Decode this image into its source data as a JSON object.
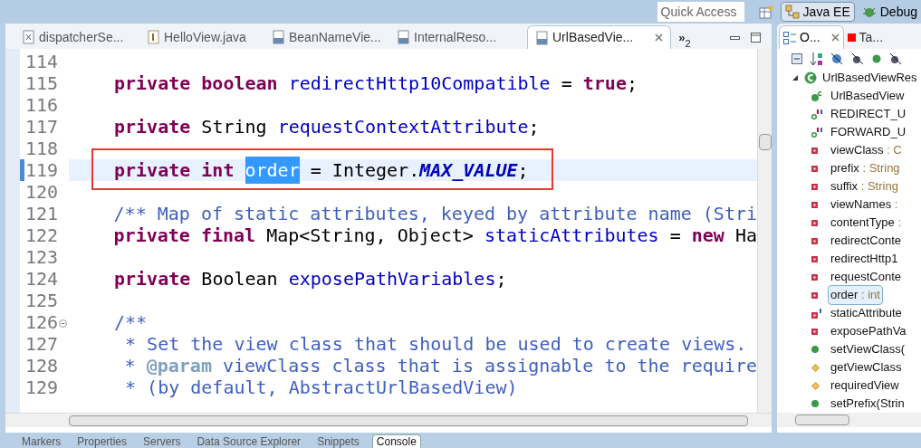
{
  "toolbar": {
    "quick_access": "Quick Access",
    "perspectives": [
      {
        "label": "Java EE",
        "selected": true,
        "kind": "javaee"
      },
      {
        "label": "Debug",
        "selected": false,
        "kind": "debug"
      }
    ]
  },
  "editor_tabs": [
    {
      "label": "dispatcherSe...",
      "kind": "xml",
      "selected": false
    },
    {
      "label": "HelloView.java",
      "kind": "java",
      "selected": false
    },
    {
      "label": "BeanNameVie...",
      "kind": "class",
      "selected": false
    },
    {
      "label": "InternalReso...",
      "kind": "class",
      "selected": false
    },
    {
      "label": "UrlBasedVie...",
      "kind": "class",
      "selected": true
    }
  ],
  "overflow": {
    "glyph": "»",
    "count": "2"
  },
  "code_lines": [
    {
      "number": "114"
    },
    {
      "number": "115",
      "tokens": [
        {
          "t": "private boolean",
          "kind": "keyword"
        },
        {
          "t": " redirectHttp10Compatible",
          "kind": "field"
        },
        {
          "t": " = ",
          "kind": "plain"
        },
        {
          "t": "true",
          "kind": "keyword"
        },
        {
          "t": ";",
          "kind": "plain"
        }
      ]
    },
    {
      "number": "116"
    },
    {
      "number": "117",
      "tokens": [
        {
          "t": "private",
          "kind": "keyword"
        },
        {
          "t": " String ",
          "kind": "plain"
        },
        {
          "t": "requestContextAttribute",
          "kind": "field"
        },
        {
          "t": ";",
          "kind": "plain"
        }
      ]
    },
    {
      "number": "118"
    },
    {
      "number": "119",
      "current": true,
      "boxed": true,
      "tokens": [
        {
          "t": "private int ",
          "kind": "keyword"
        },
        {
          "t": "order",
          "kind": "field",
          "selected": true
        },
        {
          "t": " = Integer.",
          "kind": "plain"
        },
        {
          "t": "MAX_VALUE",
          "kind": "constant"
        },
        {
          "t": ";",
          "kind": "plain"
        }
      ]
    },
    {
      "number": "120"
    },
    {
      "number": "121",
      "tokens": [
        {
          "t": "/** Map of static attributes, keyed by attribute name (Stri",
          "kind": "comment"
        }
      ]
    },
    {
      "number": "122",
      "tokens": [
        {
          "t": "private final",
          "kind": "keyword"
        },
        {
          "t": " Map<String, Object> ",
          "kind": "plain"
        },
        {
          "t": "staticAttributes",
          "kind": "field"
        },
        {
          "t": " = ",
          "kind": "plain"
        },
        {
          "t": "new",
          "kind": "keyword"
        },
        {
          "t": " Ha",
          "kind": "plain"
        }
      ]
    },
    {
      "number": "123"
    },
    {
      "number": "124",
      "tokens": [
        {
          "t": "private",
          "kind": "keyword"
        },
        {
          "t": " Boolean ",
          "kind": "plain"
        },
        {
          "t": "exposePathVariables",
          "kind": "field"
        },
        {
          "t": ";",
          "kind": "plain"
        }
      ]
    },
    {
      "number": "125"
    },
    {
      "number": "126",
      "fold": true,
      "tokens": [
        {
          "t": "/**",
          "kind": "comment"
        }
      ]
    },
    {
      "number": "127",
      "tokens": [
        {
          "t": " * Set the view class that should be used to create views.",
          "kind": "comment"
        }
      ]
    },
    {
      "number": "128",
      "tokens": [
        {
          "t": " * ",
          "kind": "comment"
        },
        {
          "t": "@param",
          "kind": "tag"
        },
        {
          "t": " viewClass class that is assignable to the require",
          "kind": "comment"
        }
      ]
    },
    {
      "number": "129",
      "tokens": [
        {
          "t": " * (by default, AbstractUrlBasedView)",
          "kind": "comment"
        }
      ]
    }
  ],
  "outline": {
    "tabs": [
      {
        "label": "O...",
        "kind": "outline",
        "selected": true
      },
      {
        "label": "Ta...",
        "kind": "tasks",
        "selected": false
      }
    ],
    "root": {
      "name": "UrlBasedViewRes",
      "expanded": true,
      "children": [
        {
          "name": "UrlBasedView",
          "kind": "constructor",
          "selected": false
        },
        {
          "name": "REDIRECT_U",
          "kind": "constant",
          "selected": false
        },
        {
          "name": "FORWARD_U",
          "kind": "constant",
          "selected": false
        },
        {
          "name": "viewClass",
          "type": " : C",
          "kind": "private",
          "selected": false
        },
        {
          "name": "prefix",
          "type": " : String",
          "kind": "private",
          "selected": false
        },
        {
          "name": "suffix",
          "type": " : String",
          "kind": "private",
          "selected": false
        },
        {
          "name": "viewNames",
          "type": " :",
          "kind": "private",
          "selected": false
        },
        {
          "name": "contentType",
          "type": " :",
          "kind": "private",
          "selected": false
        },
        {
          "name": "redirectConte",
          "kind": "private",
          "selected": false
        },
        {
          "name": "redirectHttp1",
          "kind": "private",
          "selected": false
        },
        {
          "name": "requestConte",
          "kind": "private",
          "selected": false
        },
        {
          "name": "order",
          "type": " : int",
          "kind": "private",
          "selected": true
        },
        {
          "name": "staticAttribute",
          "kind": "private_final",
          "selected": false
        },
        {
          "name": "exposePathVa",
          "kind": "private",
          "selected": false
        },
        {
          "name": "setViewClass(",
          "kind": "public",
          "selected": false
        },
        {
          "name": "getViewClass",
          "kind": "protected",
          "selected": false
        },
        {
          "name": "requiredView",
          "kind": "protected",
          "selected": false
        },
        {
          "name": "setPrefix(Strin",
          "kind": "public",
          "selected": false
        }
      ]
    }
  },
  "bottom_tabs": [
    {
      "label": "Markers",
      "selected": false
    },
    {
      "label": "Properties",
      "selected": false
    },
    {
      "label": "Servers",
      "selected": false
    },
    {
      "label": "Data Source Explorer",
      "selected": false
    },
    {
      "label": "Snippets",
      "selected": false
    },
    {
      "label": "Console",
      "selected": true
    }
  ]
}
